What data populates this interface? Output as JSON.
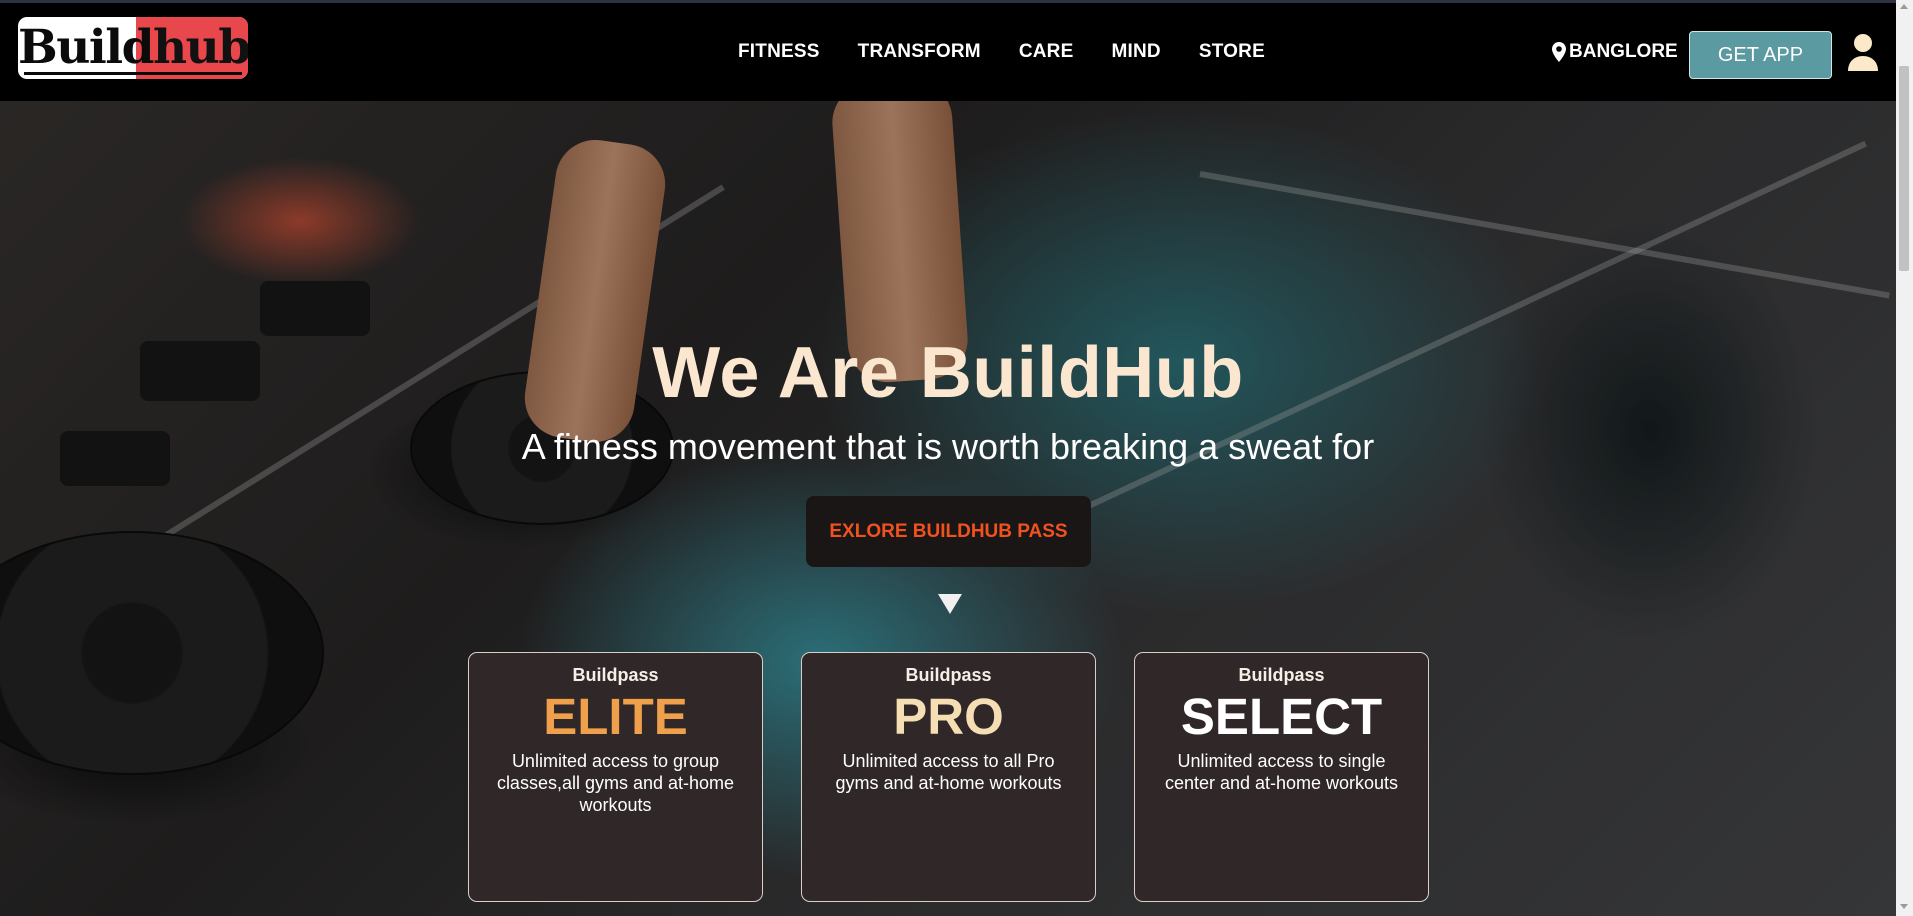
{
  "brand": {
    "logo_part1": "Build",
    "logo_part2": "hub"
  },
  "nav": {
    "links": [
      "FITNESS",
      "TRANSFORM",
      "CARE",
      "MIND",
      "STORE"
    ],
    "location": "BANGLORE",
    "get_app": "GET APP"
  },
  "hero": {
    "title": "We Are BuildHub",
    "subtitle": "A fitness movement that is worth breaking a sweat for",
    "cta": "EXLORE BUILDHUB PASS"
  },
  "cards": [
    {
      "brand": "Buildpass",
      "tier": "ELITE",
      "desc": "Unlimited access to group classes,all gyms and at-home workouts",
      "color": "#f0a04a"
    },
    {
      "brand": "Buildpass",
      "tier": "PRO",
      "desc": "Unlimited access to all Pro gyms and at-home workouts",
      "color": "#f5deb3"
    },
    {
      "brand": "Buildpass",
      "tier": "SELECT",
      "desc": "Unlimited access to single center and at-home workouts",
      "color": "#ffffff"
    }
  ],
  "colors": {
    "navbar": "#000000",
    "accent_teal": "#5b9aa0",
    "cta_text": "#f0521e",
    "title": "#fbe7cf"
  },
  "icons": {
    "location": "map-pin-icon",
    "user": "user-icon",
    "scroll": "chevron-down-icon"
  }
}
